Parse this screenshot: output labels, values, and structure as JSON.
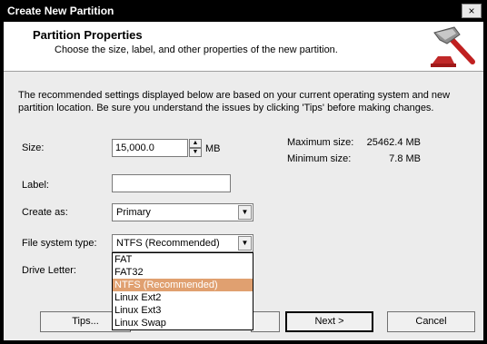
{
  "window": {
    "title": "Create New Partition",
    "close_glyph": "×"
  },
  "header": {
    "title": "Partition Properties",
    "subtitle": "Choose the size, label, and other properties of the new partition.",
    "logo_icon": "hammer-icon"
  },
  "intro": "The recommended settings displayed below are based on your current operating system and new partition location. Be sure you understand the issues by clicking 'Tips' before making changes.",
  "form": {
    "size_label": "Size:",
    "size_value": "15,000.0",
    "size_unit": "MB",
    "label_label": "Label:",
    "label_value": "",
    "create_as_label": "Create as:",
    "create_as_value": "Primary",
    "fs_label": "File system type:",
    "fs_value": "NTFS (Recommended)",
    "drive_letter_label": "Drive Letter:"
  },
  "info": {
    "max_label": "Maximum size:",
    "max_value": "25462.4 MB",
    "min_label": "Minimum size:",
    "min_value": "7.8 MB"
  },
  "fs_options": [
    "FAT",
    "FAT32",
    "NTFS (Recommended)",
    "Linux Ext2",
    "Linux Ext3",
    "Linux Swap"
  ],
  "fs_selected_index": 2,
  "buttons": {
    "tips": "Tips...",
    "next": "Next >",
    "cancel": "Cancel"
  },
  "colors": {
    "highlight": "#e0a070",
    "logo_red": "#d03030"
  }
}
